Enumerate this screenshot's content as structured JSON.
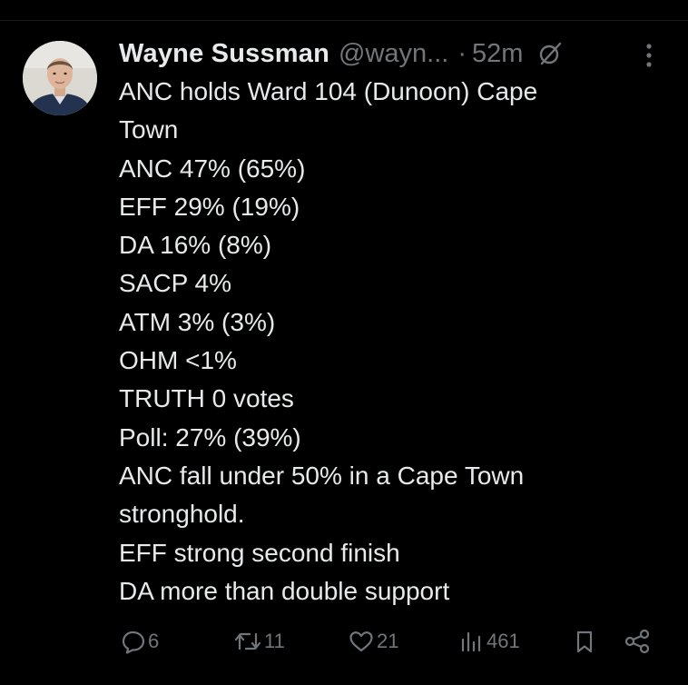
{
  "tweet": {
    "author_name": "Wayne Sussman",
    "author_handle": "@wayn...",
    "separator": "·",
    "time_ago": "52m",
    "icons": {
      "avatar": "avatar-photo",
      "grok": "grok-icon",
      "more": "more-options-icon"
    },
    "text_lines": [
      "ANC holds Ward 104 (Dunoon) Cape",
      "Town",
      "ANC 47% (65%)",
      "EFF 29% (19%)",
      "DA 16% (8%)",
      "SACP 4%",
      "ATM 3% (3%)",
      "OHM <1%",
      "TRUTH 0 votes",
      "Poll: 27% (39%)",
      "ANC fall under 50% in a Cape Town",
      "stronghold.",
      "EFF strong second finish",
      "DA more than double support"
    ],
    "actions": {
      "replies": "6",
      "reposts": "11",
      "likes": "21",
      "views": "461",
      "icons": [
        "reply-icon",
        "repost-icon",
        "like-icon",
        "views-icon",
        "bookmark-icon",
        "share-icon"
      ]
    },
    "colors": {
      "background": "#000000",
      "text": "#e7e9ea",
      "secondary": "#71767b"
    }
  }
}
